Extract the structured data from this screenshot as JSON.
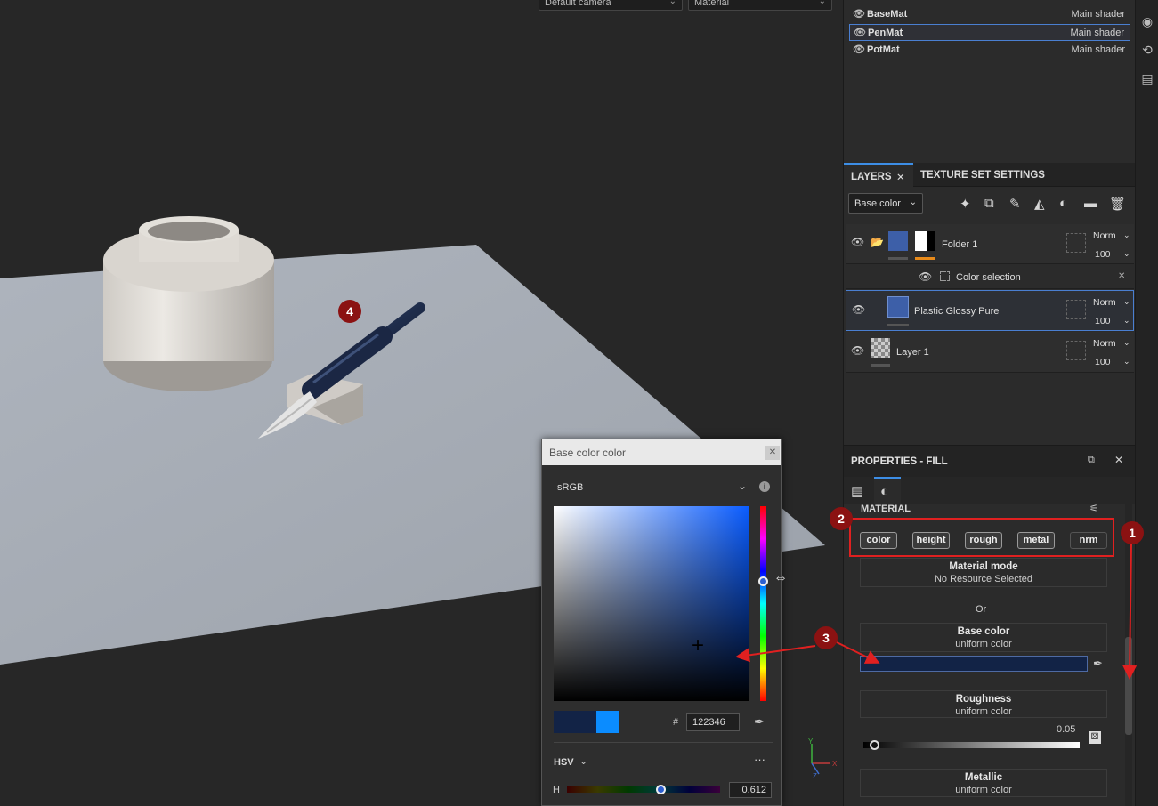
{
  "viewport": {
    "camera_select": "Default camera",
    "mode_select": "Material",
    "axis_labels": {
      "x": "X",
      "y": "Y",
      "z": "Z"
    }
  },
  "texture_sets": [
    {
      "name": "BaseMat",
      "shader": "Main shader",
      "selected": false
    },
    {
      "name": "PenMat",
      "shader": "Main shader",
      "selected": true
    },
    {
      "name": "PotMat",
      "shader": "Main shader",
      "selected": false
    }
  ],
  "layers_panel": {
    "tab_layers": "LAYERS",
    "tab_texture_set": "TEXTURE SET SETTINGS",
    "channel_select": "Base color",
    "rows": [
      {
        "name": "Folder 1",
        "blend": "Norm",
        "opacity": "100"
      },
      {
        "name": "Color selection"
      },
      {
        "name": "Plastic Glossy Pure",
        "blend": "Norm",
        "opacity": "100"
      },
      {
        "name": "Layer 1",
        "blend": "Norm",
        "opacity": "100"
      }
    ]
  },
  "properties": {
    "title": "PROPERTIES - FILL",
    "section": "MATERIAL",
    "channels": [
      "color",
      "height",
      "rough",
      "metal",
      "nrm"
    ],
    "material_mode": {
      "title": "Material mode",
      "sub": "No Resource Selected"
    },
    "or_label": "Or",
    "base_color": {
      "title": "Base color",
      "sub": "uniform color",
      "swatch": "#122346"
    },
    "roughness": {
      "title": "Roughness",
      "sub": "uniform color",
      "value": "0.05",
      "level": 0.05
    },
    "metallic": {
      "title": "Metallic",
      "sub": "uniform color"
    }
  },
  "picker": {
    "title": "Base color color",
    "color_space": "sRGB",
    "hex_label": "#",
    "hex": "122346",
    "mode": "HSV",
    "h_label": "H",
    "h_value": "0.612",
    "current_color": "#122346",
    "previous_color": "#0b8cff"
  },
  "annotations": [
    "1",
    "2",
    "3",
    "4"
  ]
}
